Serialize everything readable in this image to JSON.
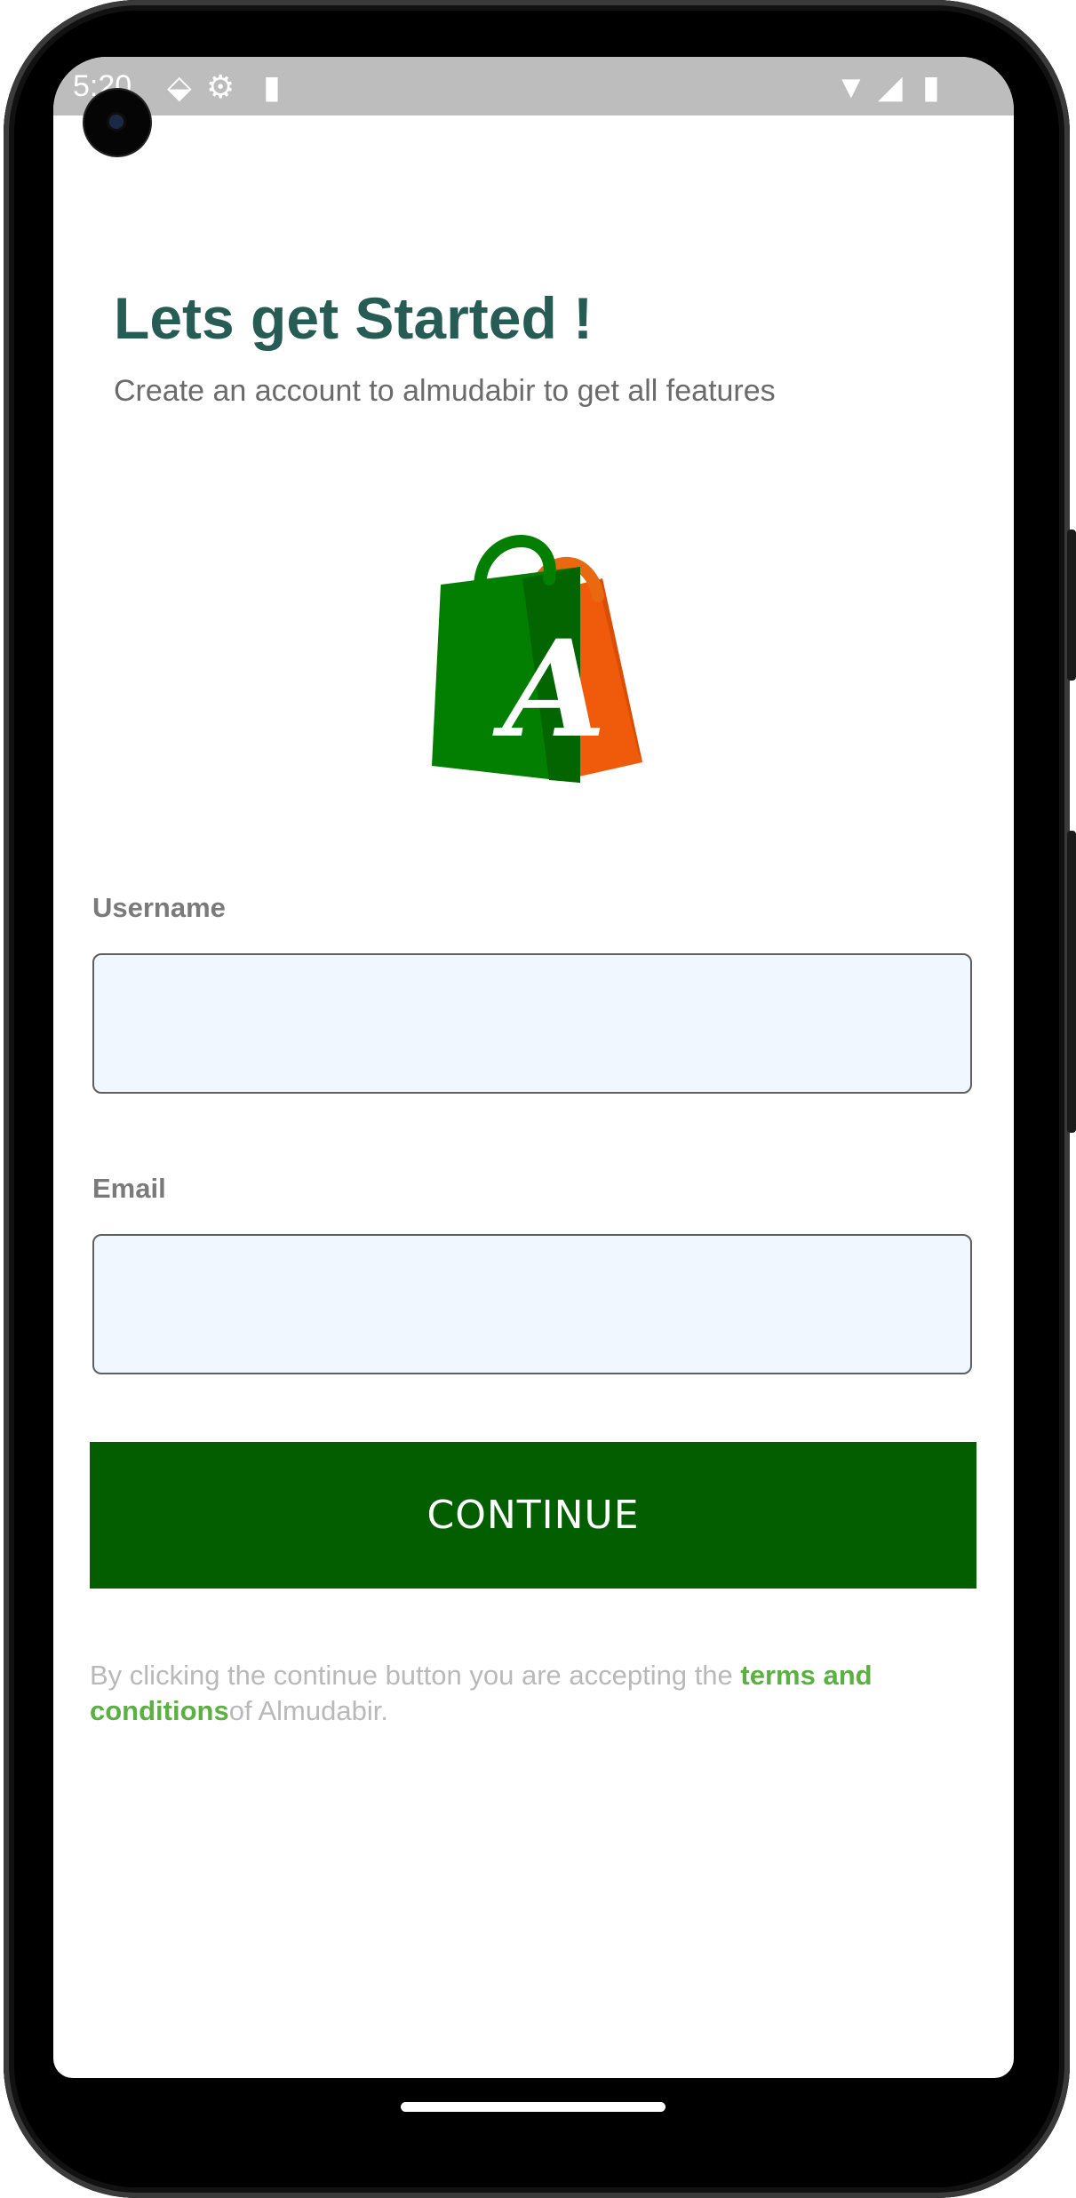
{
  "status_bar": {
    "time": "5:20"
  },
  "header": {
    "title": "Lets get Started !",
    "subtitle": "Create an account to almudabir to get all features"
  },
  "logo": {
    "letter": "A",
    "colors": {
      "bag_front": "#027f00",
      "bag_back": "#f05b0b",
      "handle": "#e8690f"
    }
  },
  "form": {
    "username": {
      "label": "Username",
      "value": ""
    },
    "email": {
      "label": "Email",
      "value": ""
    },
    "continue_label": "CONTINUE"
  },
  "terms": {
    "prefix": "By clicking the continue button you are accepting the ",
    "link": "terms and conditions",
    "suffix": "of Almudabir."
  },
  "colors": {
    "title": "#275c55",
    "button": "#035e00",
    "link": "#5bb043",
    "input_bg": "#f0f7fe"
  }
}
